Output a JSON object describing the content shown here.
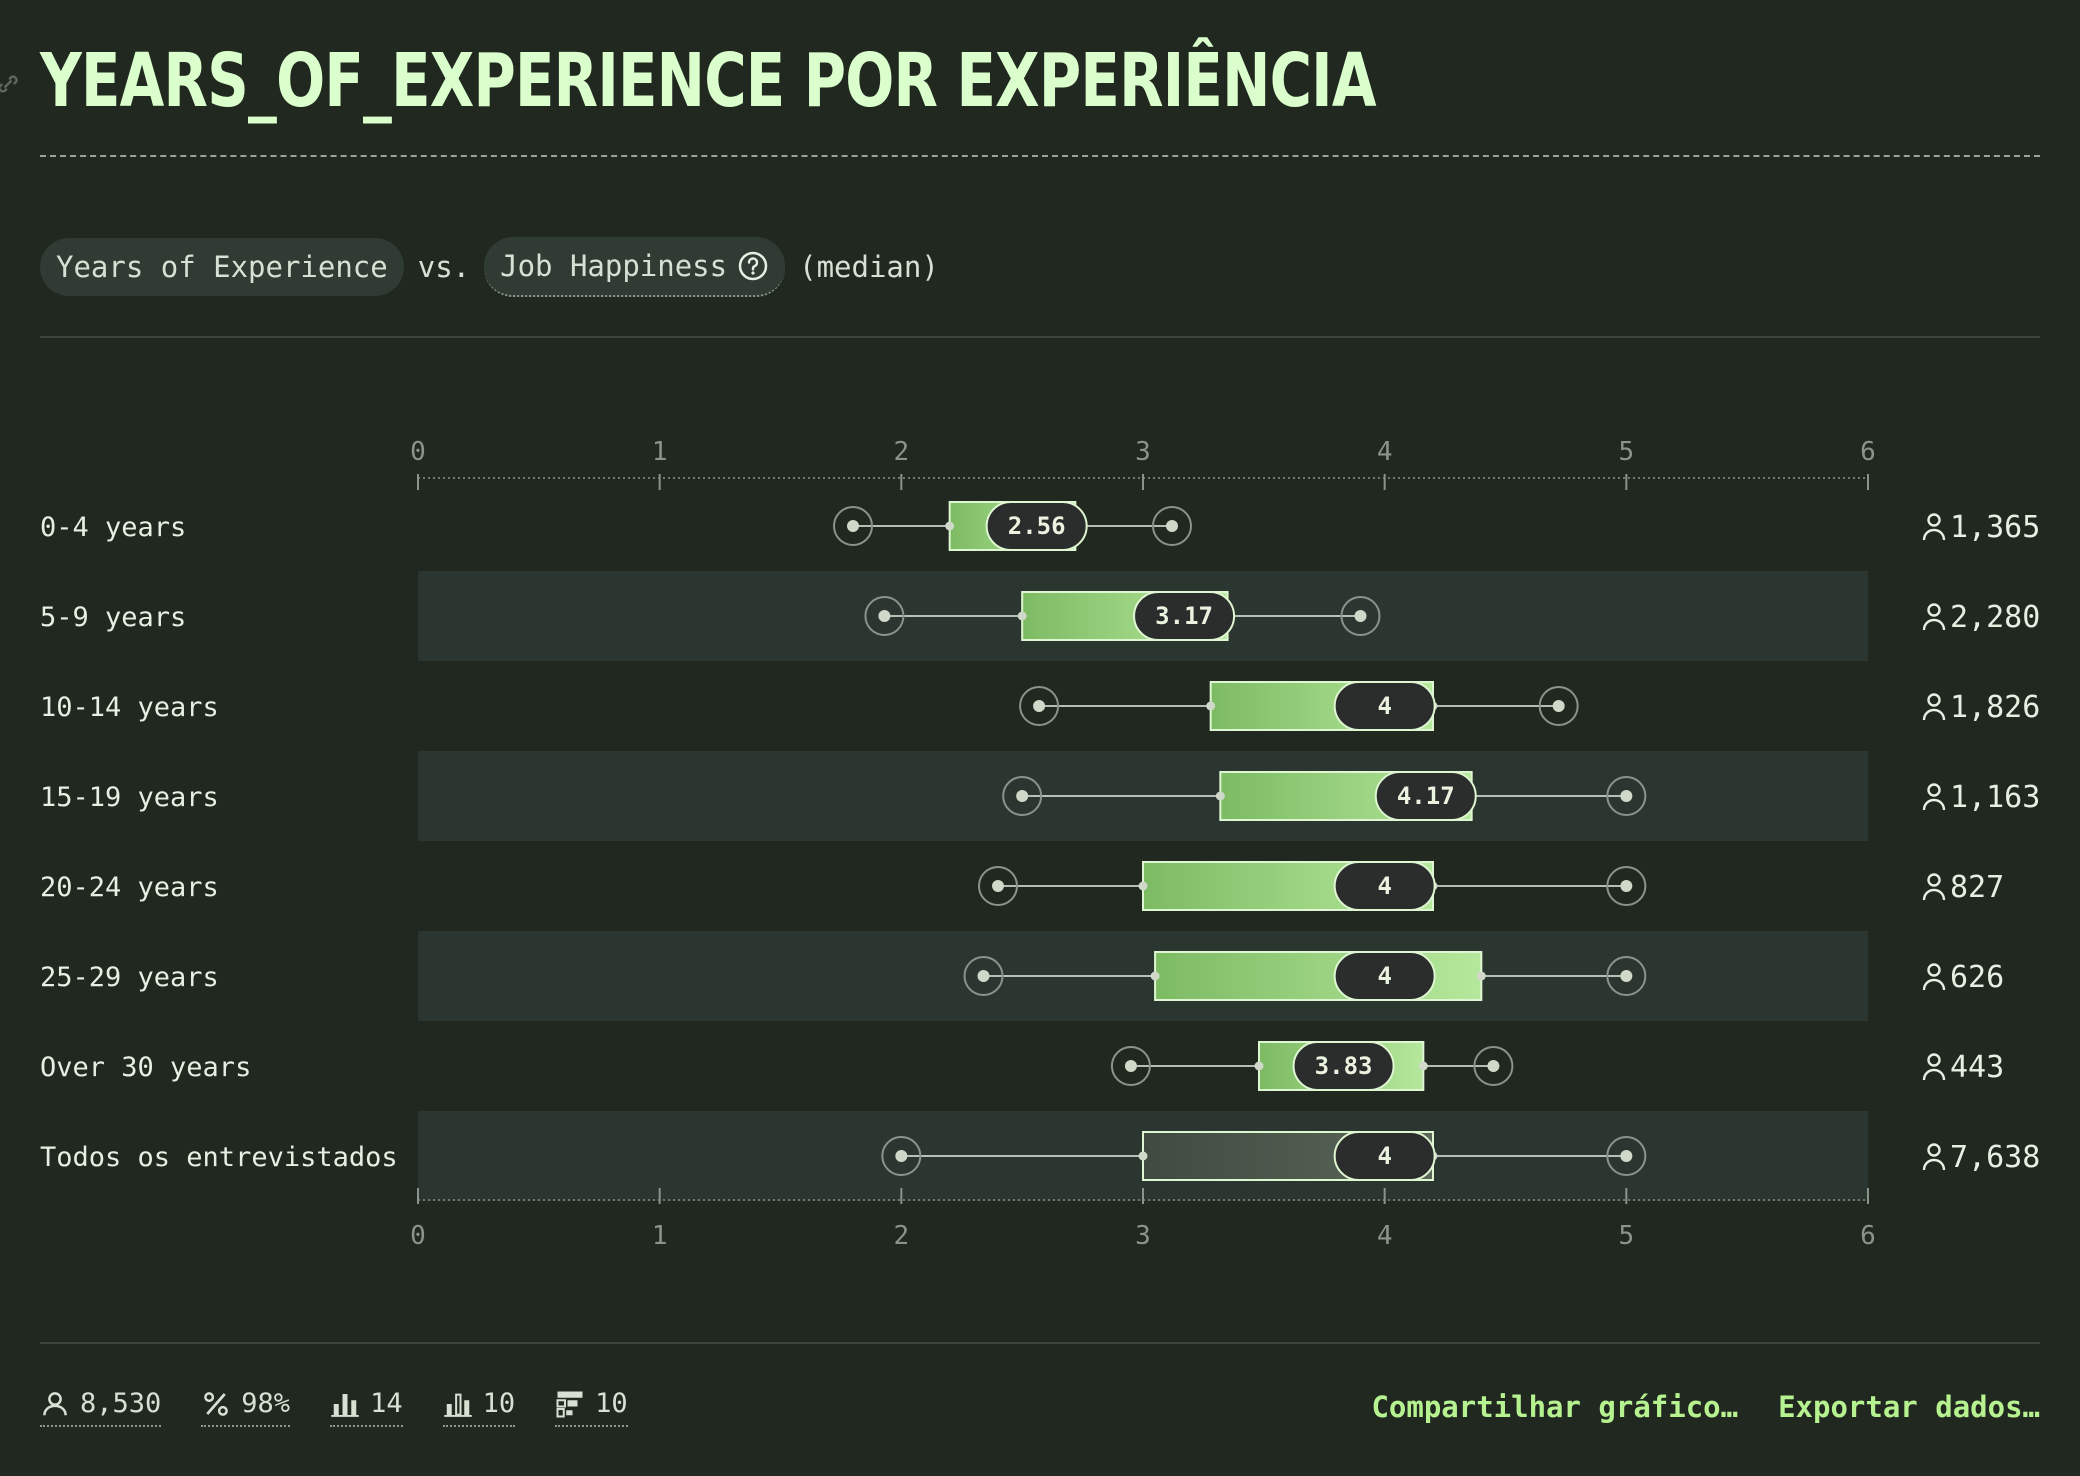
{
  "header": {
    "title": "YEARS_OF_EXPERIENCE POR EXPERIÊNCIA"
  },
  "selector": {
    "dimension_label": "Years of Experience",
    "vs_label": "vs.",
    "metric_label": "Job Happiness",
    "aggregation_label": "(median)"
  },
  "chart_data": {
    "type": "boxplot",
    "xlim": [
      0,
      6
    ],
    "x_ticks": [
      "0",
      "1",
      "2",
      "3",
      "4",
      "5",
      "6"
    ],
    "rows": [
      {
        "label": "0-4 years",
        "count": "1,365",
        "min": 1.8,
        "q1": 2.2,
        "median": 2.56,
        "median_label": "2.56",
        "q3": 2.72,
        "max": 3.12
      },
      {
        "label": "5-9 years",
        "count": "2,280",
        "min": 1.93,
        "q1": 2.5,
        "median": 3.17,
        "median_label": "3.17",
        "q3": 3.35,
        "max": 3.9
      },
      {
        "label": "10-14 years",
        "count": "1,826",
        "min": 2.57,
        "q1": 3.28,
        "median": 4,
        "median_label": "4",
        "q3": 4.2,
        "max": 4.72
      },
      {
        "label": "15-19 years",
        "count": "1,163",
        "min": 2.5,
        "q1": 3.32,
        "median": 4.17,
        "median_label": "4.17",
        "q3": 4.36,
        "max": 5
      },
      {
        "label": "20-24 years",
        "count": "827",
        "min": 2.4,
        "q1": 3,
        "median": 4,
        "median_label": "4",
        "q3": 4.2,
        "max": 5
      },
      {
        "label": "25-29 years",
        "count": "626",
        "min": 2.34,
        "q1": 3.05,
        "median": 4,
        "median_label": "4",
        "q3": 4.4,
        "max": 5
      },
      {
        "label": "Over 30 years",
        "count": "443",
        "min": 2.95,
        "q1": 3.48,
        "median": 3.83,
        "median_label": "3.83",
        "q3": 4.16,
        "max": 4.45
      },
      {
        "label": "Todos os entrevistados",
        "count": "7,638",
        "min": 2,
        "q1": 3,
        "median": 4,
        "median_label": "4",
        "q3": 4.2,
        "max": 5,
        "overall": true
      }
    ],
    "colors": {
      "box_start": "#7dbb63",
      "box_end": "#b5e89c",
      "overall_box": "#4e5a4f",
      "median_pill": "#2b2d2c"
    }
  },
  "footer": {
    "stats": [
      {
        "icon": "person-icon",
        "value": "8,530"
      },
      {
        "icon": "percent-icon",
        "value": "98%"
      },
      {
        "icon": "bar-chart-icon",
        "value": "14"
      },
      {
        "icon": "bar-chart-outline-icon",
        "value": "10"
      },
      {
        "icon": "filter-icon",
        "value": "10"
      }
    ],
    "share_label": "Compartilhar gráfico…",
    "export_label": "Exportar dados…"
  }
}
